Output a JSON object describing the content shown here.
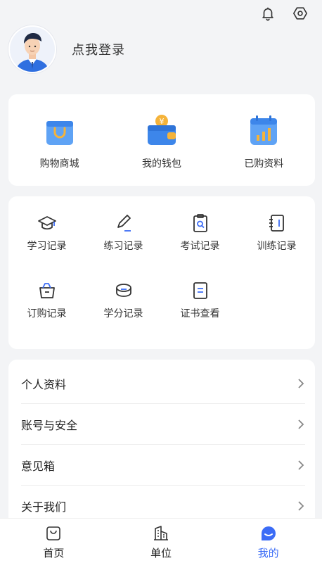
{
  "header": {
    "bell_icon": "bell-icon",
    "settings_icon": "settings-hex-icon",
    "avatar_icon": "user-avatar-illustration",
    "login_text": "点我登录"
  },
  "quick_links": [
    {
      "label": "购物商城",
      "icon": "shopping-bag-icon"
    },
    {
      "label": "我的钱包",
      "icon": "wallet-icon"
    },
    {
      "label": "已购资料",
      "icon": "calendar-chart-icon"
    }
  ],
  "records": [
    {
      "label": "学习记录",
      "icon": "graduation-cap-icon"
    },
    {
      "label": "练习记录",
      "icon": "pencil-icon"
    },
    {
      "label": "考试记录",
      "icon": "clipboard-search-icon"
    },
    {
      "label": "训练记录",
      "icon": "notebook-icon"
    },
    {
      "label": "订购记录",
      "icon": "basket-icon"
    },
    {
      "label": "学分记录",
      "icon": "coins-icon"
    },
    {
      "label": "证书查看",
      "icon": "document-icon"
    }
  ],
  "menu": [
    {
      "label": "个人资料"
    },
    {
      "label": "账号与安全"
    },
    {
      "label": "意见箱"
    },
    {
      "label": "关于我们"
    }
  ],
  "tabbar": [
    {
      "label": "首页",
      "icon": "shopping-bag-outline-icon",
      "active": false
    },
    {
      "label": "单位",
      "icon": "building-icon",
      "active": false
    },
    {
      "label": "我的",
      "icon": "profile-filled-icon",
      "active": true
    }
  ],
  "colors": {
    "accent": "#3b6cf6",
    "background": "#f3f4f6",
    "icon_orange": "#f5a623"
  }
}
